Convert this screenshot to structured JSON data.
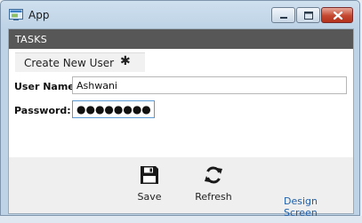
{
  "window": {
    "title": "App",
    "icon": "app-window-icon",
    "controls": [
      "minimize-icon",
      "maximize-icon",
      "close-icon"
    ]
  },
  "tasks": {
    "header": "TASKS"
  },
  "tab": {
    "label": "Create New User",
    "modified_marker": "✱"
  },
  "form": {
    "username": {
      "label": "User Name:",
      "value": "Ashwani"
    },
    "password": {
      "label": "Password:",
      "value": "●●●●●●●●●●●●"
    }
  },
  "actions": {
    "save": {
      "label": "Save",
      "icon": "save-icon"
    },
    "refresh": {
      "label": "Refresh",
      "icon": "refresh-icon"
    }
  },
  "link": {
    "design_screen": "Design Screen"
  }
}
